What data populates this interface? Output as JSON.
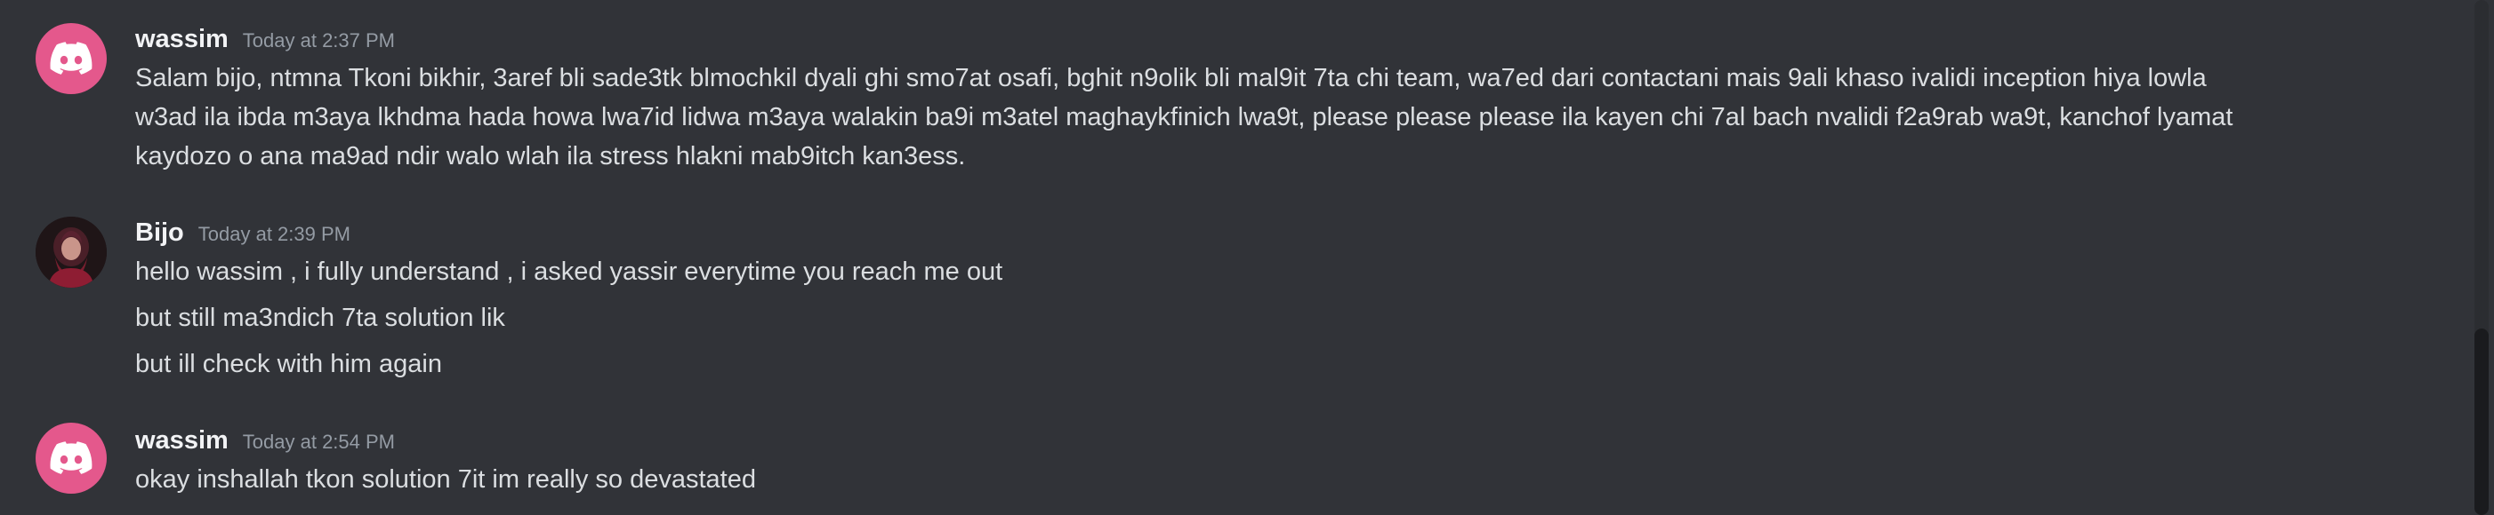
{
  "messages": [
    {
      "author": "wassim",
      "timestamp": "Today at 2:37 PM",
      "avatar_icon": "discord-logo-icon",
      "avatar_color": "#e4588c",
      "lines": [
        "Salam bijo, ntmna Tkoni bikhir, 3aref bli sade3tk blmochkil dyali ghi smo7at osafi, bghit n9olik bli mal9it 7ta chi team, wa7ed dari contactani mais 9ali khaso ivalidi inception hiya lowla",
        "w3ad ila ibda m3aya lkhdma hada howa lwa7id lidwa m3aya walakin ba9i m3atel maghaykfinich lwa9t, please please please ila kayen chi 7al bach nvalidi f2a9rab wa9t, kanchof lyamat",
        "kaydozo o ana ma9ad ndir walo wlah ila stress hlakni mab9itch kan3ess."
      ]
    },
    {
      "author": "Bijo",
      "timestamp": "Today at 2:39 PM",
      "avatar_icon": "user-photo-avatar",
      "lines": [
        "hello wassim , i fully understand , i asked yassir everytime you reach me out",
        "but still ma3ndich 7ta solution lik",
        "but ill check with him again"
      ]
    },
    {
      "author": "wassim",
      "timestamp": "Today at 2:54 PM",
      "avatar_icon": "discord-logo-icon",
      "avatar_color": "#e4588c",
      "lines": [
        "okay inshallah tkon solution 7it im really so devastated"
      ]
    }
  ]
}
